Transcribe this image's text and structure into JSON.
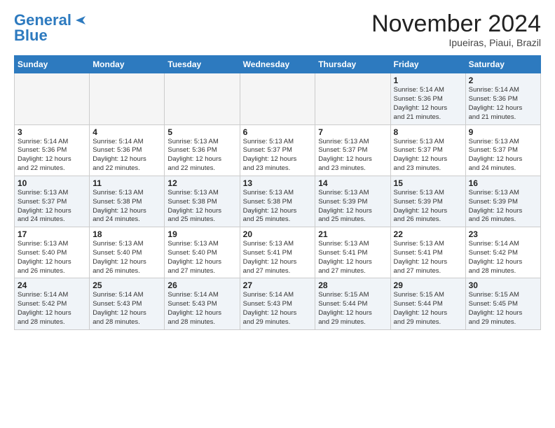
{
  "header": {
    "logo_line1": "General",
    "logo_line2": "Blue",
    "month": "November 2024",
    "location": "Ipueiras, Piaui, Brazil"
  },
  "weekdays": [
    "Sunday",
    "Monday",
    "Tuesday",
    "Wednesday",
    "Thursday",
    "Friday",
    "Saturday"
  ],
  "weeks": [
    [
      {
        "day": "",
        "info": ""
      },
      {
        "day": "",
        "info": ""
      },
      {
        "day": "",
        "info": ""
      },
      {
        "day": "",
        "info": ""
      },
      {
        "day": "",
        "info": ""
      },
      {
        "day": "1",
        "info": "Sunrise: 5:14 AM\nSunset: 5:36 PM\nDaylight: 12 hours\nand 21 minutes."
      },
      {
        "day": "2",
        "info": "Sunrise: 5:14 AM\nSunset: 5:36 PM\nDaylight: 12 hours\nand 21 minutes."
      }
    ],
    [
      {
        "day": "3",
        "info": "Sunrise: 5:14 AM\nSunset: 5:36 PM\nDaylight: 12 hours\nand 22 minutes."
      },
      {
        "day": "4",
        "info": "Sunrise: 5:14 AM\nSunset: 5:36 PM\nDaylight: 12 hours\nand 22 minutes."
      },
      {
        "day": "5",
        "info": "Sunrise: 5:13 AM\nSunset: 5:36 PM\nDaylight: 12 hours\nand 22 minutes."
      },
      {
        "day": "6",
        "info": "Sunrise: 5:13 AM\nSunset: 5:37 PM\nDaylight: 12 hours\nand 23 minutes."
      },
      {
        "day": "7",
        "info": "Sunrise: 5:13 AM\nSunset: 5:37 PM\nDaylight: 12 hours\nand 23 minutes."
      },
      {
        "day": "8",
        "info": "Sunrise: 5:13 AM\nSunset: 5:37 PM\nDaylight: 12 hours\nand 23 minutes."
      },
      {
        "day": "9",
        "info": "Sunrise: 5:13 AM\nSunset: 5:37 PM\nDaylight: 12 hours\nand 24 minutes."
      }
    ],
    [
      {
        "day": "10",
        "info": "Sunrise: 5:13 AM\nSunset: 5:37 PM\nDaylight: 12 hours\nand 24 minutes."
      },
      {
        "day": "11",
        "info": "Sunrise: 5:13 AM\nSunset: 5:38 PM\nDaylight: 12 hours\nand 24 minutes."
      },
      {
        "day": "12",
        "info": "Sunrise: 5:13 AM\nSunset: 5:38 PM\nDaylight: 12 hours\nand 25 minutes."
      },
      {
        "day": "13",
        "info": "Sunrise: 5:13 AM\nSunset: 5:38 PM\nDaylight: 12 hours\nand 25 minutes."
      },
      {
        "day": "14",
        "info": "Sunrise: 5:13 AM\nSunset: 5:39 PM\nDaylight: 12 hours\nand 25 minutes."
      },
      {
        "day": "15",
        "info": "Sunrise: 5:13 AM\nSunset: 5:39 PM\nDaylight: 12 hours\nand 26 minutes."
      },
      {
        "day": "16",
        "info": "Sunrise: 5:13 AM\nSunset: 5:39 PM\nDaylight: 12 hours\nand 26 minutes."
      }
    ],
    [
      {
        "day": "17",
        "info": "Sunrise: 5:13 AM\nSunset: 5:40 PM\nDaylight: 12 hours\nand 26 minutes."
      },
      {
        "day": "18",
        "info": "Sunrise: 5:13 AM\nSunset: 5:40 PM\nDaylight: 12 hours\nand 26 minutes."
      },
      {
        "day": "19",
        "info": "Sunrise: 5:13 AM\nSunset: 5:40 PM\nDaylight: 12 hours\nand 27 minutes."
      },
      {
        "day": "20",
        "info": "Sunrise: 5:13 AM\nSunset: 5:41 PM\nDaylight: 12 hours\nand 27 minutes."
      },
      {
        "day": "21",
        "info": "Sunrise: 5:13 AM\nSunset: 5:41 PM\nDaylight: 12 hours\nand 27 minutes."
      },
      {
        "day": "22",
        "info": "Sunrise: 5:13 AM\nSunset: 5:41 PM\nDaylight: 12 hours\nand 27 minutes."
      },
      {
        "day": "23",
        "info": "Sunrise: 5:14 AM\nSunset: 5:42 PM\nDaylight: 12 hours\nand 28 minutes."
      }
    ],
    [
      {
        "day": "24",
        "info": "Sunrise: 5:14 AM\nSunset: 5:42 PM\nDaylight: 12 hours\nand 28 minutes."
      },
      {
        "day": "25",
        "info": "Sunrise: 5:14 AM\nSunset: 5:43 PM\nDaylight: 12 hours\nand 28 minutes."
      },
      {
        "day": "26",
        "info": "Sunrise: 5:14 AM\nSunset: 5:43 PM\nDaylight: 12 hours\nand 28 minutes."
      },
      {
        "day": "27",
        "info": "Sunrise: 5:14 AM\nSunset: 5:43 PM\nDaylight: 12 hours\nand 29 minutes."
      },
      {
        "day": "28",
        "info": "Sunrise: 5:15 AM\nSunset: 5:44 PM\nDaylight: 12 hours\nand 29 minutes."
      },
      {
        "day": "29",
        "info": "Sunrise: 5:15 AM\nSunset: 5:44 PM\nDaylight: 12 hours\nand 29 minutes."
      },
      {
        "day": "30",
        "info": "Sunrise: 5:15 AM\nSunset: 5:45 PM\nDaylight: 12 hours\nand 29 minutes."
      }
    ]
  ]
}
